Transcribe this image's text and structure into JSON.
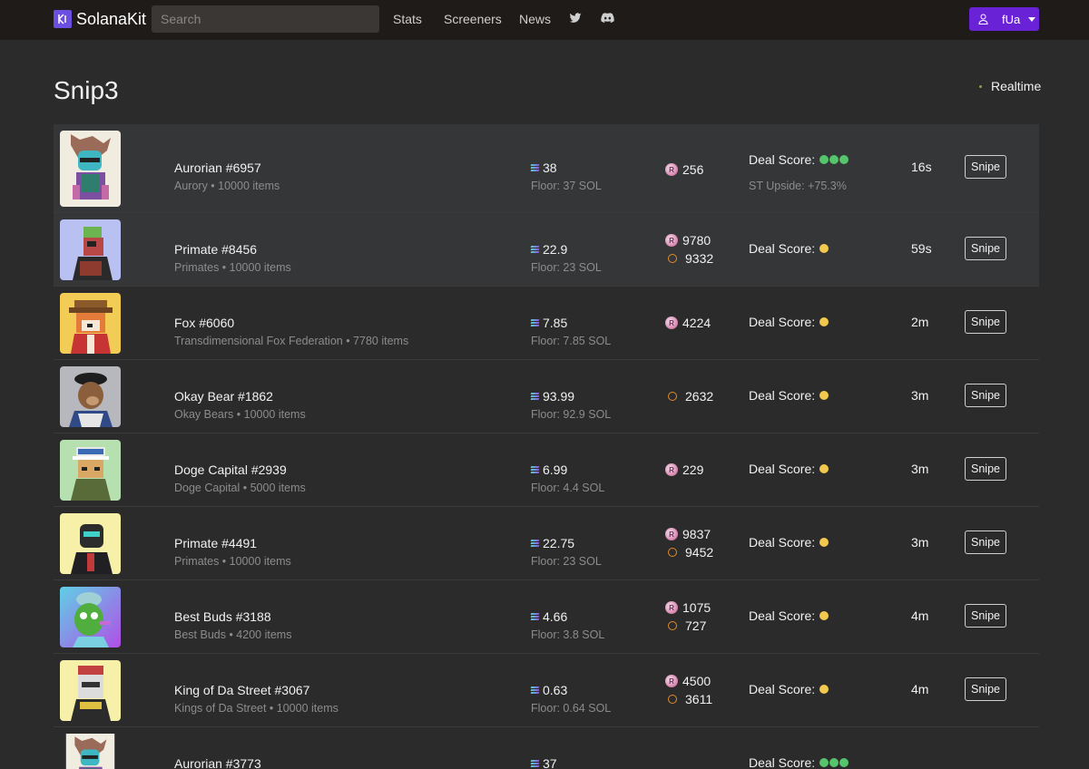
{
  "nav": {
    "brand": "SolanaKit",
    "search_placeholder": "Search",
    "links": [
      "Stats",
      "Screeners",
      "News"
    ],
    "user": "fUa",
    "accent": "#6a22d6"
  },
  "page": {
    "title": "Snip3",
    "realtime_label": "Realtime"
  },
  "listings": [
    {
      "name": "Aurorian #6957",
      "collection": "Aurory • 10000 items",
      "price": "38",
      "floor": "Floor: 37 SOL",
      "ranks": [
        {
          "icon": "rarity-r",
          "value": "256"
        }
      ],
      "deal_label": "Deal Score:",
      "deal_dots": [
        "green",
        "green",
        "green"
      ],
      "upside": "ST Upside: +75.3%",
      "age": "16s",
      "action": "Snipe",
      "thumb": "aurorian"
    },
    {
      "name": "Primate #8456",
      "collection": "Primates • 10000 items",
      "price": "22.9",
      "floor": "Floor: 23 SOL",
      "ranks": [
        {
          "icon": "rarity-r",
          "value": "9780"
        },
        {
          "icon": "rarity-o",
          "value": "9332"
        }
      ],
      "deal_label": "Deal Score:",
      "deal_dots": [
        "yellow"
      ],
      "upside": "",
      "age": "59s",
      "action": "Snipe",
      "thumb": "primate-blue"
    },
    {
      "name": "Fox #6060",
      "collection": "Transdimensional Fox Federation • 7780 items",
      "price": "7.85",
      "floor": "Floor: 7.85 SOL",
      "ranks": [
        {
          "icon": "rarity-r",
          "value": "4224"
        }
      ],
      "deal_label": "Deal Score:",
      "deal_dots": [
        "yellow"
      ],
      "upside": "",
      "age": "2m",
      "action": "Snipe",
      "thumb": "fox"
    },
    {
      "name": "Okay Bear #1862",
      "collection": "Okay Bears • 10000 items",
      "price": "93.99",
      "floor": "Floor: 92.9 SOL",
      "ranks": [
        {
          "icon": "rarity-o",
          "value": "2632"
        }
      ],
      "deal_label": "Deal Score:",
      "deal_dots": [
        "yellow"
      ],
      "upside": "",
      "age": "3m",
      "action": "Snipe",
      "thumb": "bear"
    },
    {
      "name": "Doge Capital #2939",
      "collection": "Doge Capital • 5000 items",
      "price": "6.99",
      "floor": "Floor: 4.4 SOL",
      "ranks": [
        {
          "icon": "rarity-r",
          "value": "229"
        }
      ],
      "deal_label": "Deal Score:",
      "deal_dots": [
        "yellow"
      ],
      "upside": "",
      "age": "3m",
      "action": "Snipe",
      "thumb": "doge"
    },
    {
      "name": "Primate #4491",
      "collection": "Primates • 10000 items",
      "price": "22.75",
      "floor": "Floor: 23 SOL",
      "ranks": [
        {
          "icon": "rarity-r",
          "value": "9837"
        },
        {
          "icon": "rarity-o",
          "value": "9452"
        }
      ],
      "deal_label": "Deal Score:",
      "deal_dots": [
        "yellow"
      ],
      "upside": "",
      "age": "3m",
      "action": "Snipe",
      "thumb": "primate-yellow"
    },
    {
      "name": "Best Buds #3188",
      "collection": "Best Buds • 4200 items",
      "price": "4.66",
      "floor": "Floor: 3.8 SOL",
      "ranks": [
        {
          "icon": "rarity-r",
          "value": "1075"
        },
        {
          "icon": "rarity-o",
          "value": "727"
        }
      ],
      "deal_label": "Deal Score:",
      "deal_dots": [
        "yellow"
      ],
      "upside": "",
      "age": "4m",
      "action": "Snipe",
      "thumb": "bud"
    },
    {
      "name": "King of Da Street #3067",
      "collection": "Kings of Da Street • 10000 items",
      "price": "0.63",
      "floor": "Floor: 0.64 SOL",
      "ranks": [
        {
          "icon": "rarity-r",
          "value": "4500"
        },
        {
          "icon": "rarity-o",
          "value": "3611"
        }
      ],
      "deal_label": "Deal Score:",
      "deal_dots": [
        "yellow"
      ],
      "upside": "",
      "age": "4m",
      "action": "Snipe",
      "thumb": "king"
    },
    {
      "name": "Aurorian #3773",
      "collection": "",
      "price": "37",
      "floor": "",
      "ranks": [],
      "deal_label": "Deal Score:",
      "deal_dots": [
        "green",
        "green",
        "green"
      ],
      "upside": "",
      "age": "",
      "action": "",
      "thumb": "aurorian"
    }
  ]
}
